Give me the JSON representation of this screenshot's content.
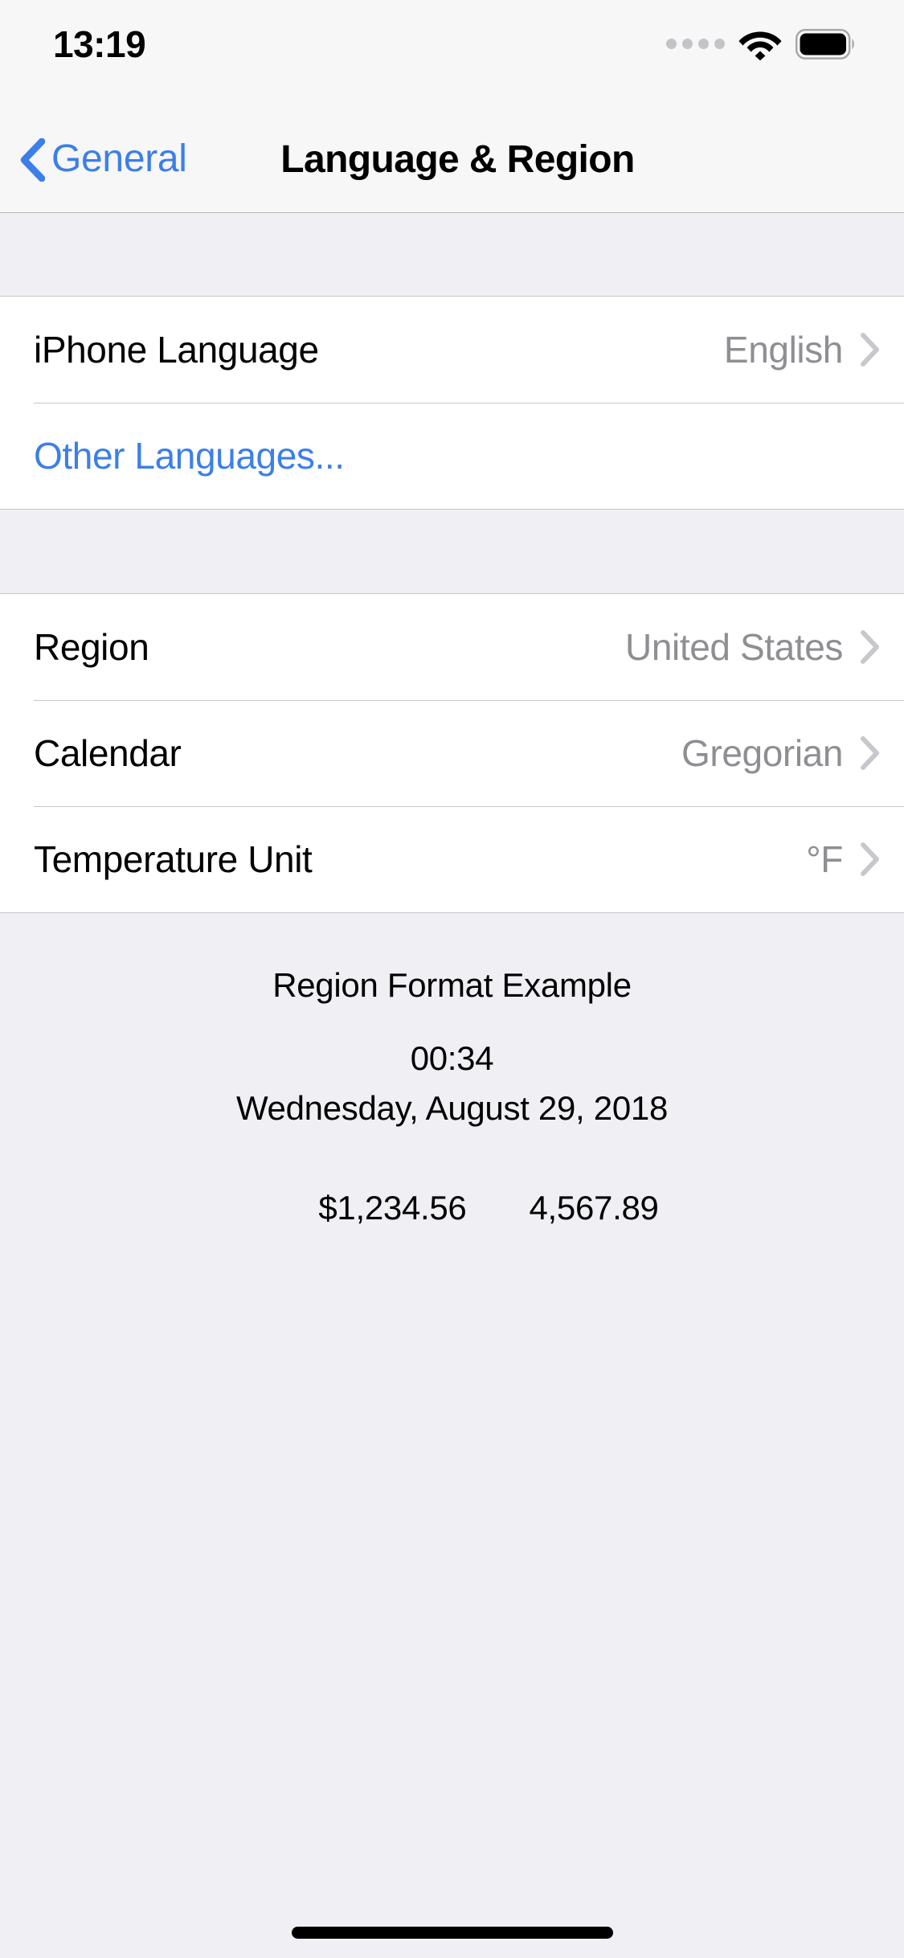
{
  "status_bar": {
    "time": "13:19",
    "signal_icon": "signal-dots-icon",
    "wifi_icon": "wifi-icon",
    "battery_icon": "battery-full-icon"
  },
  "nav_bar": {
    "back_label": "General",
    "back_icon": "chevron-left-icon",
    "title": "Language & Region"
  },
  "sections": [
    {
      "rows": [
        {
          "label": "iPhone Language",
          "value": "English",
          "accessory": "chevron-right-icon"
        },
        {
          "label": "Other Languages...",
          "value": "",
          "accessory": ""
        }
      ]
    },
    {
      "rows": [
        {
          "label": "Region",
          "value": "United States",
          "accessory": "chevron-right-icon"
        },
        {
          "label": "Calendar",
          "value": "Gregorian",
          "accessory": "chevron-right-icon"
        },
        {
          "label": "Temperature Unit",
          "value": "°F",
          "accessory": "chevron-right-icon"
        }
      ]
    }
  ],
  "footer": {
    "title": "Region Format Example",
    "time": "00:34",
    "date": "Wednesday, August 29, 2018",
    "currency": "$1,234.56",
    "number": "4,567.89"
  },
  "colors": {
    "accent_blue": "#3C7FE8",
    "value_gray": "#8E8E93",
    "page_background": "#EFEFF4",
    "row_background": "#FFFFFF",
    "separator": "#C8C7CC",
    "bar_background": "#F7F7F7"
  }
}
